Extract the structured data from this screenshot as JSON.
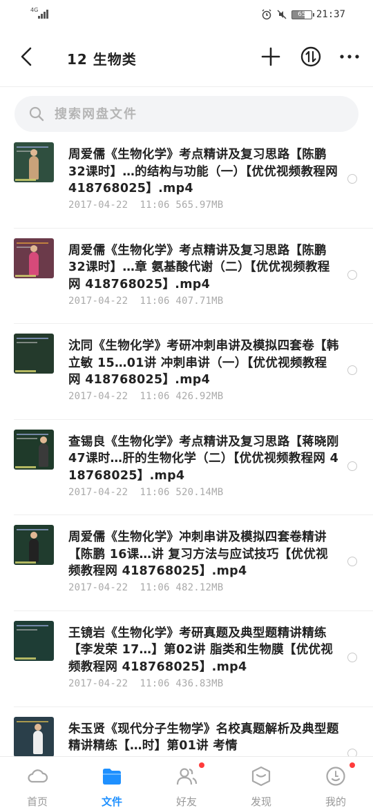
{
  "status_bar": {
    "network": "4G",
    "battery": "65",
    "time": "21:37"
  },
  "header": {
    "title": "12 生物类"
  },
  "search": {
    "placeholder": "搜索网盘文件"
  },
  "files": [
    {
      "name": "周爱儒《生物化学》考点精讲及复习思路【陈鹏 32课时】…的结构与功能（一）【优优视频教程网 418768025】.mp4",
      "meta": "2017-04-22  11:06 565.97MB",
      "thumb_bg": "#2f4f3f"
    },
    {
      "name": "周爱儒《生物化学》考点精讲及复习思路【陈鹏 32课时】…章 氨基酸代谢（二）【优优视频教程网 418768025】.mp4",
      "meta": "2017-04-22  11:06 407.71MB",
      "thumb_bg": "#6b3a4a"
    },
    {
      "name": "沈同《生物化学》考研冲刺串讲及模拟四套卷【韩立敏 15…01讲 冲刺串讲（一）【优优视频教程网 418768025】.mp4",
      "meta": "2017-04-22  11:06 426.92MB",
      "thumb_bg": "#243a2c"
    },
    {
      "name": "查锡良《生物化学》考点精讲及复习思路【蒋晓刚 47课时…肝的生物化学（二）【优优视频教程网 418768025】.mp4",
      "meta": "2017-04-22  11:06 520.14MB",
      "thumb_bg": "#1f3a2a"
    },
    {
      "name": "周爱儒《生物化学》冲刺串讲及模拟四套卷精讲【陈鹏 16课…讲 复习方法与应试技巧【优优视频教程网 418768025】.mp4",
      "meta": "2017-04-22  11:06 482.12MB",
      "thumb_bg": "#203c2e"
    },
    {
      "name": "王镜岩《生物化学》考研真题及典型题精讲精练【李发荣 17…】第02讲 脂类和生物膜【优优视频教程网 418768025】.mp4",
      "meta": "2017-04-22  11:06 436.83MB",
      "thumb_bg": "#1e3d35"
    },
    {
      "name": "朱玉贤《现代分子生物学》名校真题解析及典型题精讲精练【…时】第01讲 考情",
      "meta": "",
      "thumb_bg": "#2a3f4a"
    }
  ],
  "nav": {
    "items": [
      {
        "label": "首页",
        "icon": "cloud-icon"
      },
      {
        "label": "文件",
        "icon": "folder-icon"
      },
      {
        "label": "好友",
        "icon": "friends-icon"
      },
      {
        "label": "发现",
        "icon": "discover-icon"
      },
      {
        "label": "我的",
        "icon": "profile-icon"
      }
    ],
    "active_color": "#1e90ff"
  }
}
